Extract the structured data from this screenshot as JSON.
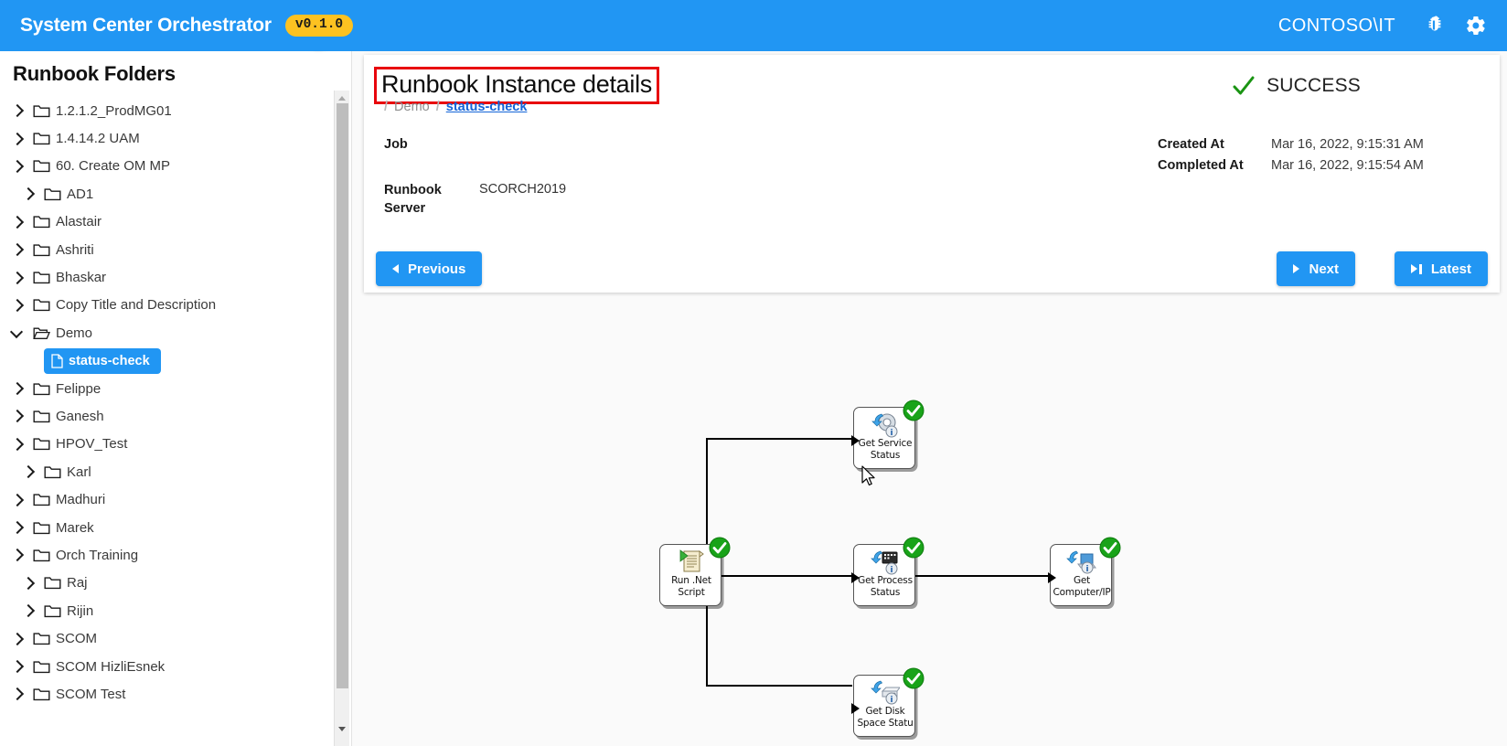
{
  "topbar": {
    "brand": "System Center Orchestrator",
    "version": "v0.1.0",
    "user": "CONTOSO\\IT",
    "bug_icon": "bug-icon",
    "settings_icon": "gear-icon"
  },
  "sidebar": {
    "title": "Runbook Folders",
    "collapse_icon": "collapse-expand-icon",
    "folders": [
      {
        "label": "1.2.1.2_ProdMG01",
        "expanded": false,
        "indent": false
      },
      {
        "label": "1.4.14.2 UAM",
        "expanded": false,
        "indent": false
      },
      {
        "label": "60. Create OM MP",
        "expanded": false,
        "indent": false
      },
      {
        "label": "AD1",
        "expanded": false,
        "indent": true
      },
      {
        "label": "Alastair",
        "expanded": false,
        "indent": false
      },
      {
        "label": "Ashriti",
        "expanded": false,
        "indent": false
      },
      {
        "label": "Bhaskar",
        "expanded": false,
        "indent": false
      },
      {
        "label": "Copy Title and Description",
        "expanded": false,
        "indent": false
      },
      {
        "label": "Demo",
        "expanded": true,
        "indent": false
      },
      {
        "label": "Felippe",
        "expanded": false,
        "indent": false
      },
      {
        "label": "Ganesh",
        "expanded": false,
        "indent": false
      },
      {
        "label": "HPOV_Test",
        "expanded": false,
        "indent": false
      },
      {
        "label": "Karl",
        "expanded": false,
        "indent": true
      },
      {
        "label": "Madhuri",
        "expanded": false,
        "indent": false
      },
      {
        "label": "Marek",
        "expanded": false,
        "indent": false
      },
      {
        "label": "Orch Training",
        "expanded": false,
        "indent": false
      },
      {
        "label": "Raj",
        "expanded": false,
        "indent": true
      },
      {
        "label": "Rijin",
        "expanded": false,
        "indent": true
      },
      {
        "label": "SCOM",
        "expanded": false,
        "indent": false
      },
      {
        "label": "SCOM HizliEsnek",
        "expanded": false,
        "indent": false
      },
      {
        "label": "SCOM Test",
        "expanded": false,
        "indent": false
      }
    ],
    "selected_runbook": "status-check"
  },
  "detail": {
    "title": "Runbook Instance details",
    "breadcrumb": {
      "sep": "/",
      "folder": "Demo",
      "runbook": "status-check"
    },
    "job_label": "Job",
    "server_key": "Runbook Server",
    "server_value": "SCORCH2019",
    "status": "SUCCESS",
    "status_color": "#1a9413",
    "meta": [
      {
        "key": "Created At",
        "value": "Mar 16, 2022, 9:15:31 AM"
      },
      {
        "key": "Completed At",
        "value": "Mar 16, 2022, 9:15:54 AM"
      }
    ],
    "buttons": {
      "previous": "Previous",
      "next": "Next",
      "latest": "Latest"
    }
  },
  "diagram": {
    "nodes": [
      {
        "id": "run-net-script",
        "label": "Run .Net\nScript",
        "icon": "script-icon",
        "status": "success"
      },
      {
        "id": "get-service-status",
        "label": "Get Service\nStatus",
        "icon": "service-gear-icon",
        "status": "success"
      },
      {
        "id": "get-process-status",
        "label": "Get Process\nStatus",
        "icon": "process-monitor-icon",
        "status": "success"
      },
      {
        "id": "get-computer-ip",
        "label": "Get\nComputer/IP",
        "icon": "computer-icon",
        "status": "success"
      },
      {
        "id": "get-disk-space-status",
        "label": "Get Disk\nSpace Statu",
        "icon": "disk-icon",
        "status": "success"
      }
    ],
    "links": [
      {
        "from": "run-net-script",
        "to": "get-service-status"
      },
      {
        "from": "run-net-script",
        "to": "get-process-status"
      },
      {
        "from": "run-net-script",
        "to": "get-disk-space-status"
      },
      {
        "from": "get-process-status",
        "to": "get-computer-ip"
      }
    ]
  },
  "colors": {
    "accent": "#2196f3",
    "badge": "#fdc221",
    "success": "#1a9413",
    "highlight": "#e8050c"
  }
}
